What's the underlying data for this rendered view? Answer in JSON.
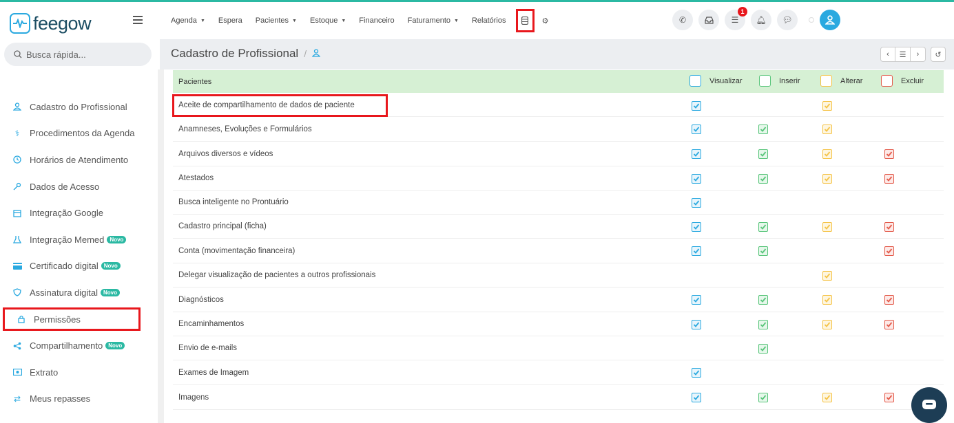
{
  "brand": {
    "name": "feegow",
    "accent": "#2aa9e0",
    "teal": "#2bb9a3",
    "alert": "#e8171c"
  },
  "search": {
    "placeholder": "Busca rápida..."
  },
  "sidebar": {
    "items": [
      {
        "label": "Cadastro do Profissional",
        "icon": "user-icon"
      },
      {
        "label": "Procedimentos da Agenda",
        "icon": "stethoscope-icon"
      },
      {
        "label": "Horários de Atendimento",
        "icon": "clock-icon"
      },
      {
        "label": "Dados de Acesso",
        "icon": "key-icon"
      },
      {
        "label": "Integração Google",
        "icon": "calendar-icon"
      },
      {
        "label": "Integração Memed",
        "icon": "flask-icon",
        "badge": "Novo"
      },
      {
        "label": "Certificado digital",
        "icon": "card-icon",
        "badge": "Novo"
      },
      {
        "label": "Assinatura digital",
        "icon": "shield-icon",
        "badge": "Novo"
      },
      {
        "label": "Permissões",
        "icon": "lock-icon"
      },
      {
        "label": "Compartilhamento",
        "icon": "share-icon",
        "badge": "Novo"
      },
      {
        "label": "Extrato",
        "icon": "money-icon"
      },
      {
        "label": "Meus repasses",
        "icon": "transfer-icon"
      }
    ]
  },
  "topnav": {
    "menu": [
      {
        "label": "Agenda",
        "dropdown": true
      },
      {
        "label": "Espera",
        "dropdown": false
      },
      {
        "label": "Pacientes",
        "dropdown": true
      },
      {
        "label": "Estoque",
        "dropdown": true
      },
      {
        "label": "Financeiro",
        "dropdown": false
      },
      {
        "label": "Faturamento",
        "dropdown": true
      },
      {
        "label": "Relatórios",
        "dropdown": false
      }
    ],
    "notification_count": "1"
  },
  "page": {
    "title": "Cadastro de Profissional"
  },
  "permissions": {
    "section": "Pacientes",
    "columns": [
      "Visualizar",
      "Inserir",
      "Alterar",
      "Excluir"
    ],
    "rows": [
      {
        "label": "Aceite de compartilhamento de dados de paciente",
        "v": true,
        "i": false,
        "a": true,
        "e": false
      },
      {
        "label": "Anamneses, Evoluções e Formulários",
        "v": true,
        "i": true,
        "a": true,
        "e": false
      },
      {
        "label": "Arquivos diversos e vídeos",
        "v": true,
        "i": true,
        "a": true,
        "e": true
      },
      {
        "label": "Atestados",
        "v": true,
        "i": true,
        "a": true,
        "e": true
      },
      {
        "label": "Busca inteligente no Prontuário",
        "v": true,
        "i": false,
        "a": false,
        "e": false
      },
      {
        "label": "Cadastro principal (ficha)",
        "v": true,
        "i": true,
        "a": true,
        "e": true
      },
      {
        "label": "Conta (movimentação financeira)",
        "v": true,
        "i": true,
        "a": false,
        "e": true
      },
      {
        "label": "Delegar visualização de pacientes a outros profissionais",
        "v": false,
        "i": false,
        "a": true,
        "e": false
      },
      {
        "label": "Diagnósticos",
        "v": true,
        "i": true,
        "a": true,
        "e": true
      },
      {
        "label": "Encaminhamentos",
        "v": true,
        "i": true,
        "a": true,
        "e": true
      },
      {
        "label": "Envio de e-mails",
        "v": false,
        "i": true,
        "a": false,
        "e": false
      },
      {
        "label": "Exames de Imagem",
        "v": true,
        "i": false,
        "a": false,
        "e": false
      },
      {
        "label": "Imagens",
        "v": true,
        "i": true,
        "a": true,
        "e": true
      }
    ]
  }
}
